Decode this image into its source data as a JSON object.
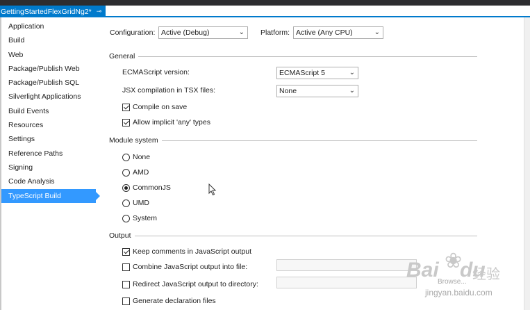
{
  "tab": {
    "title": "GettingStartedFlexGridNg2*",
    "pin_glyph": "⊸",
    "close_glyph": "✕"
  },
  "sidebar": {
    "items": [
      {
        "label": "Application"
      },
      {
        "label": "Build"
      },
      {
        "label": "Web"
      },
      {
        "label": "Package/Publish Web"
      },
      {
        "label": "Package/Publish SQL"
      },
      {
        "label": "Silverlight Applications"
      },
      {
        "label": "Build Events"
      },
      {
        "label": "Resources"
      },
      {
        "label": "Settings"
      },
      {
        "label": "Reference Paths"
      },
      {
        "label": "Signing"
      },
      {
        "label": "Code Analysis"
      },
      {
        "label": "TypeScript Build",
        "active": true
      }
    ]
  },
  "config": {
    "configuration_label": "Configuration:",
    "configuration_value": "Active (Debug)",
    "platform_label": "Platform:",
    "platform_value": "Active (Any CPU)"
  },
  "general": {
    "title": "General",
    "ecma_label": "ECMAScript version:",
    "ecma_value": "ECMAScript 5",
    "jsx_label": "JSX compilation in TSX files:",
    "jsx_value": "None",
    "compile_on_save": {
      "label": "Compile on save",
      "checked": true
    },
    "allow_any": {
      "label": "Allow implicit 'any' types",
      "checked": true
    }
  },
  "module_system": {
    "title": "Module system",
    "options": [
      {
        "label": "None",
        "selected": false
      },
      {
        "label": "AMD",
        "selected": false
      },
      {
        "label": "CommonJS",
        "selected": true
      },
      {
        "label": "UMD",
        "selected": false
      },
      {
        "label": "System",
        "selected": false
      }
    ]
  },
  "output": {
    "title": "Output",
    "keep_comments": {
      "label": "Keep comments in JavaScript output",
      "checked": true
    },
    "combine": {
      "label": "Combine JavaScript output into file:",
      "checked": false,
      "value": ""
    },
    "redirect": {
      "label": "Redirect JavaScript output to directory:",
      "checked": false,
      "value": ""
    },
    "generate_decl": {
      "label": "Generate declaration files",
      "checked": false
    }
  },
  "watermark": {
    "brand": "Bai",
    "brand2": "du",
    "brand_cn": "经验",
    "sub": "jingyan.baidu.com",
    "browse": "Browse..."
  },
  "colors": {
    "accent": "#007acc",
    "selection": "#3399ff"
  }
}
